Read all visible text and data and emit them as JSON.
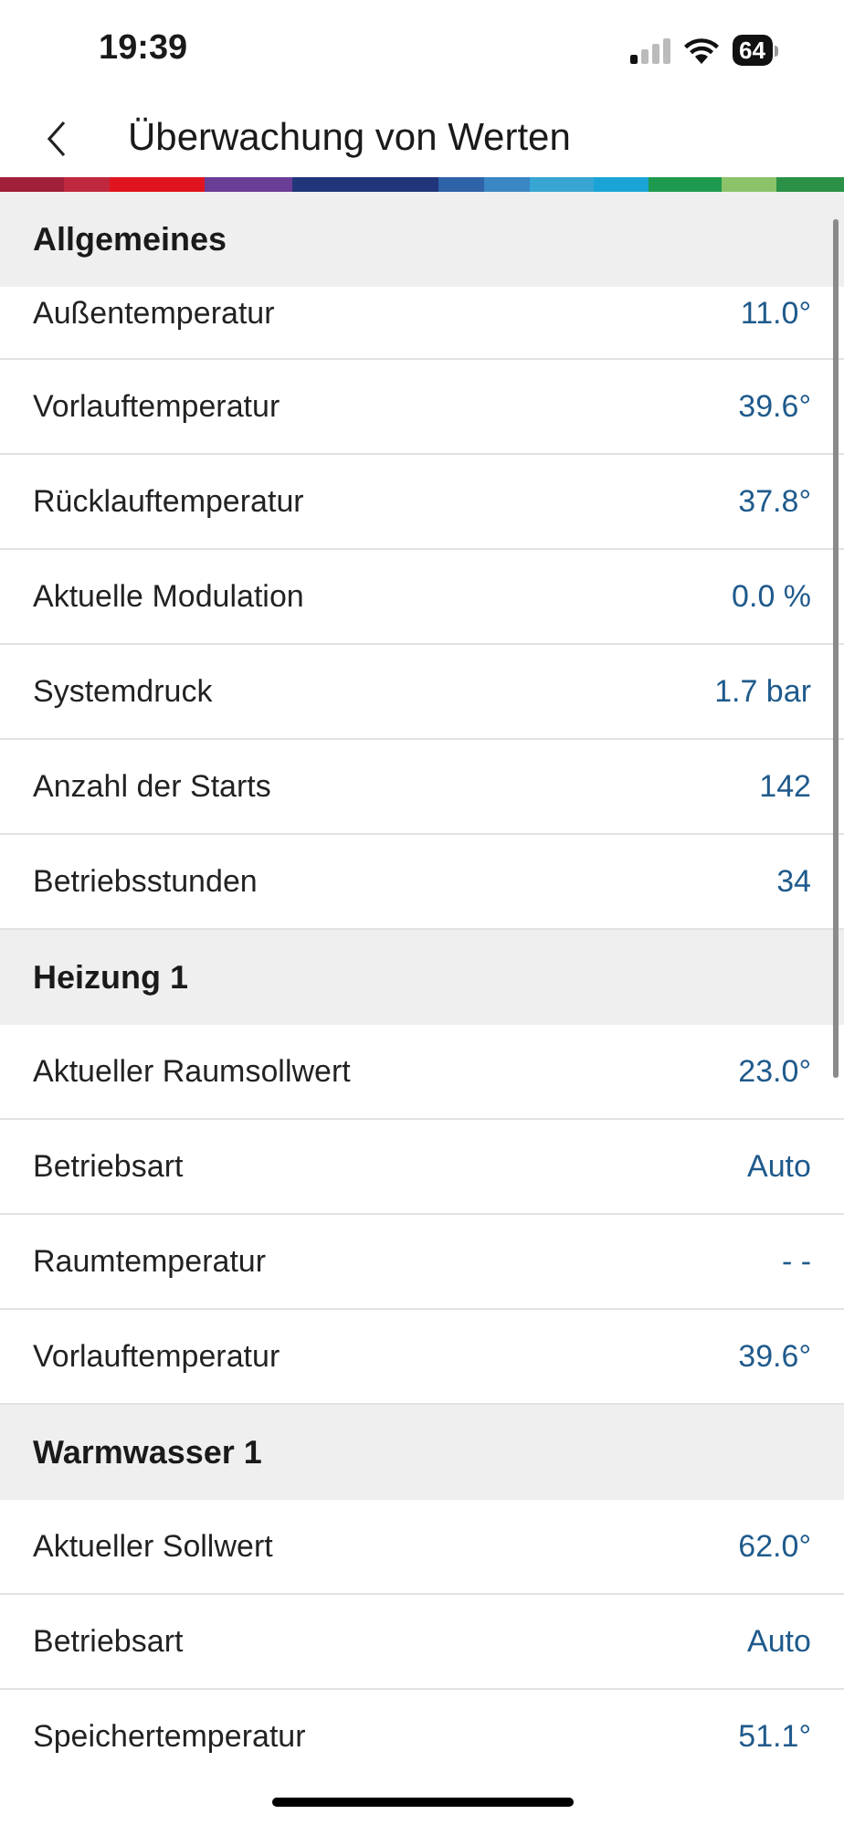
{
  "status_bar": {
    "time": "19:39",
    "battery": "64"
  },
  "header": {
    "title": "Überwachung von Werten"
  },
  "sections": [
    {
      "title": "Allgemeines",
      "rows": [
        {
          "label": "Außentemperatur",
          "value": "11.0°"
        },
        {
          "label": "Vorlauftemperatur",
          "value": "39.6°"
        },
        {
          "label": "Rücklauftemperatur",
          "value": "37.8°"
        },
        {
          "label": "Aktuelle Modulation",
          "value": "0.0 %"
        },
        {
          "label": "Systemdruck",
          "value": "1.7 bar"
        },
        {
          "label": "Anzahl der Starts",
          "value": "142"
        },
        {
          "label": "Betriebsstunden",
          "value": "34"
        }
      ]
    },
    {
      "title": "Heizung 1",
      "rows": [
        {
          "label": "Aktueller Raumsollwert",
          "value": "23.0°"
        },
        {
          "label": "Betriebsart",
          "value": "Auto"
        },
        {
          "label": "Raumtemperatur",
          "value": "- -"
        },
        {
          "label": "Vorlauftemperatur",
          "value": "39.6°"
        }
      ]
    },
    {
      "title": "Warmwasser 1",
      "rows": [
        {
          "label": "Aktueller Sollwert",
          "value": "62.0°"
        },
        {
          "label": "Betriebsart",
          "value": "Auto"
        },
        {
          "label": "Speichertemperatur",
          "value": "51.1°"
        }
      ]
    }
  ]
}
